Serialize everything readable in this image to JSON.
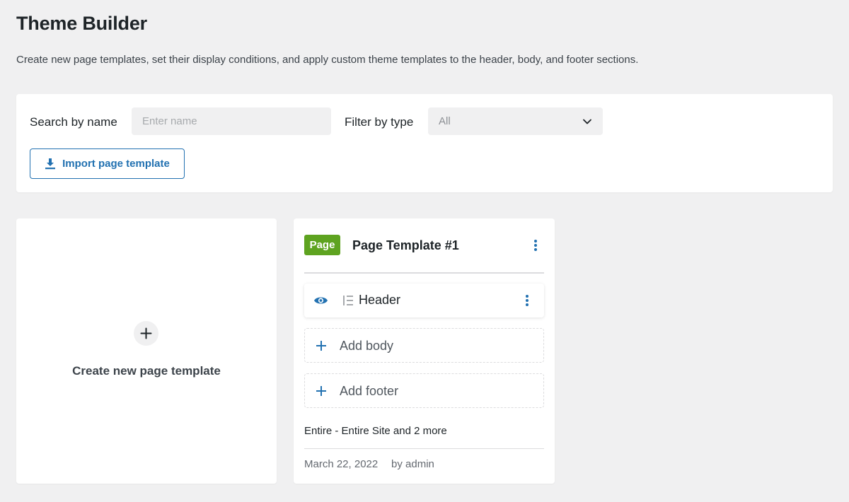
{
  "header": {
    "title": "Theme Builder",
    "description": "Create new page templates, set their display conditions, and apply custom theme templates to the header, body, and footer sections."
  },
  "filters": {
    "search_label": "Search by name",
    "search_placeholder": "Enter name",
    "search_value": "",
    "type_label": "Filter by type",
    "type_selected": "All",
    "import_label": "Import page template"
  },
  "create_card": {
    "label": "Create new page template"
  },
  "templates": [
    {
      "badge": "Page",
      "badge_color": "#5ea320",
      "title": "Page Template #1",
      "sections": [
        {
          "label": "Header",
          "icon": "eye-icon",
          "type_icon": "layout-icon"
        }
      ],
      "add_body_label": "Add body",
      "add_footer_label": "Add footer",
      "conditions": "Entire - Entire Site and 2 more",
      "date": "March 22, 2022",
      "author": "by admin"
    }
  ],
  "colors": {
    "accent": "#2271b1",
    "background": "#f0f0f1",
    "badge_green": "#5ea320"
  }
}
